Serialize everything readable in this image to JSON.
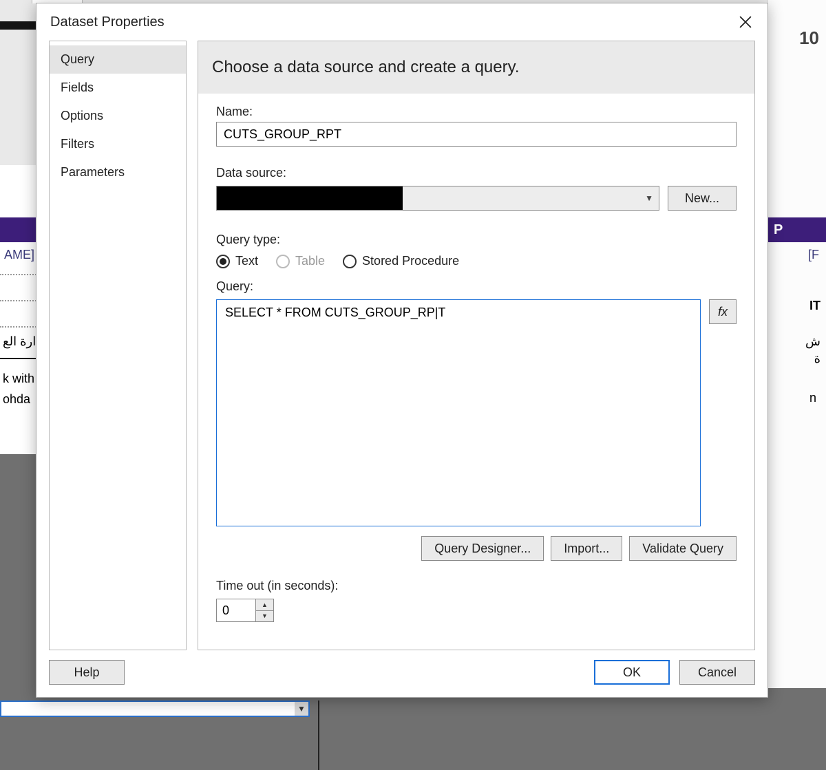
{
  "dialog": {
    "title": "Dataset Properties",
    "nav": {
      "items": [
        {
          "label": "Query",
          "active": true
        },
        {
          "label": "Fields"
        },
        {
          "label": "Options"
        },
        {
          "label": "Filters"
        },
        {
          "label": "Parameters"
        }
      ]
    },
    "panel": {
      "heading": "Choose a data source and create a query.",
      "name_label": "Name:",
      "name_value": "CUTS_GROUP_RPT",
      "ds_label": "Data source:",
      "ds_value": "",
      "ds_new": "New...",
      "qtype_label": "Query type:",
      "qtype_options": {
        "text": "Text",
        "table": "Table",
        "sproc": "Stored Procedure"
      },
      "qtype_selected": "text",
      "query_label": "Query:",
      "query_text": "SELECT * FROM CUTS_GROUP_RP|T",
      "fx_label": "fx",
      "buttons": {
        "designer": "Query Designer...",
        "import": "Import...",
        "validate": "Validate Query"
      },
      "timeout_label": "Time out (in seconds):",
      "timeout_value": "0"
    },
    "footer": {
      "help": "Help",
      "ok": "OK",
      "cancel": "Cancel"
    }
  },
  "background": {
    "left_placeholder": "AME]",
    "arabic_frag_1": "دارة الع",
    "frag_k": "k with",
    "frag_ohda": "ohda",
    "right_letters": "10",
    "right_P": "P",
    "right_bracket": "[F",
    "right_IT": "IT",
    "right_ar": "ش\nة",
    "right_n": "n"
  }
}
